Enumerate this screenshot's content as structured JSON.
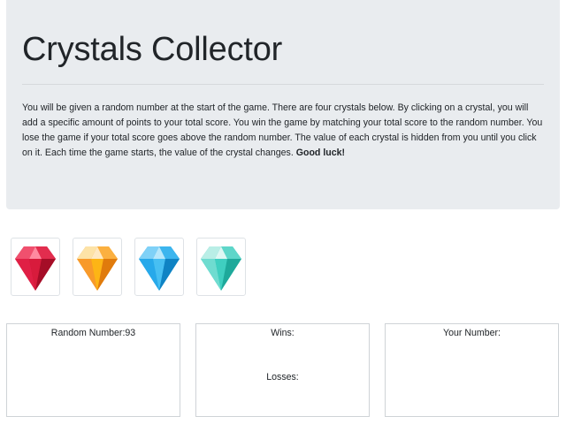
{
  "header": {
    "title": "Crystals Collector",
    "description_text": "You will be given a random number at the start of the game. There are four crystals below. By clicking on a crystal, you will add a specific amount of points to your total score. You win the game by matching your total score to the random number. You lose the game if your total score goes above the random number. The value of each crystal is hidden from you until you click on it. Each time the game starts, the value of the crystal changes.",
    "description_bold": "Good luck!"
  },
  "crystals": [
    {
      "icon": "red-crystal-icon",
      "color": "#d81b3c"
    },
    {
      "icon": "orange-crystal-icon",
      "color": "#f7941d"
    },
    {
      "icon": "blue-crystal-icon",
      "color": "#1ca1e2"
    },
    {
      "icon": "teal-crystal-icon",
      "color": "#2ec4b6"
    }
  ],
  "stats": {
    "random_number_label": "Random Number:",
    "random_number_value": "93",
    "wins_label": "Wins:",
    "wins_value": "",
    "losses_label": "Losses:",
    "losses_value": "",
    "your_number_label": "Your Number:",
    "your_number_value": ""
  }
}
